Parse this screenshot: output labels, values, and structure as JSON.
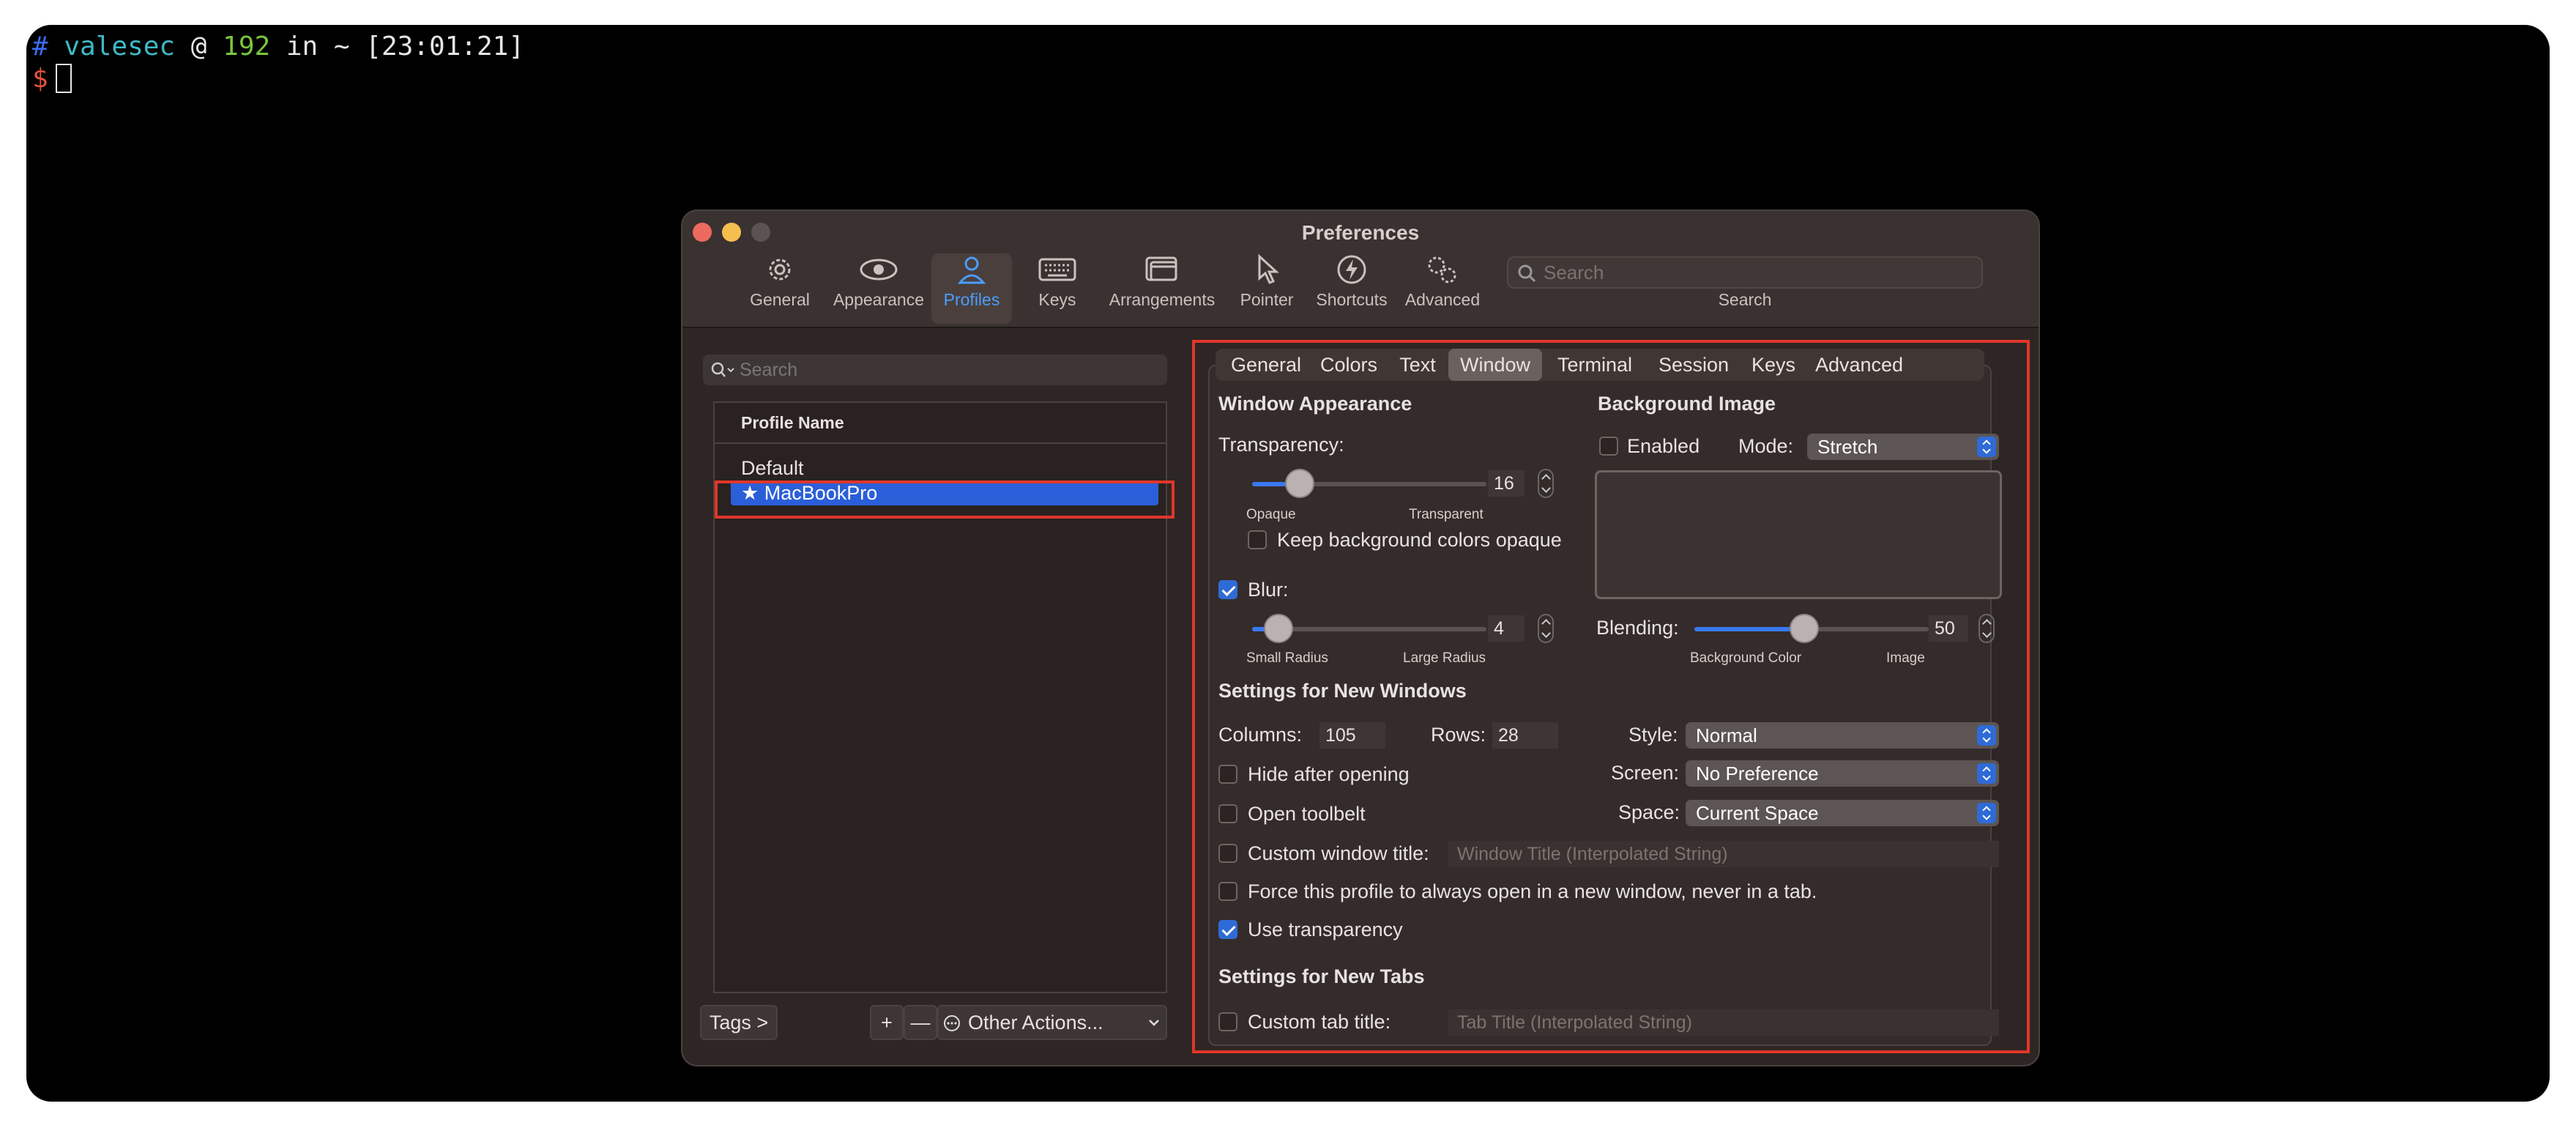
{
  "terminal": {
    "prompt_hash": "#",
    "user": "valesec",
    "at": "@",
    "host": "192",
    "in_text": "in ~",
    "time": "[23:01:21]",
    "dollar": "$"
  },
  "window": {
    "title": "Preferences"
  },
  "toolbar": {
    "items": [
      {
        "label": "General",
        "icon": "gear-icon"
      },
      {
        "label": "Appearance",
        "icon": "eye-icon"
      },
      {
        "label": "Profiles",
        "icon": "person-icon",
        "active": true
      },
      {
        "label": "Keys",
        "icon": "keyboard-icon"
      },
      {
        "label": "Arrangements",
        "icon": "windows-icon"
      },
      {
        "label": "Pointer",
        "icon": "pointer-icon"
      },
      {
        "label": "Shortcuts",
        "icon": "bolt-icon"
      },
      {
        "label": "Advanced",
        "icon": "gears-icon"
      }
    ],
    "search_placeholder": "Search",
    "search_label": "Search"
  },
  "profiles": {
    "search_placeholder": "Search",
    "header": "Profile Name",
    "items": [
      "Default",
      "★ MacBookPro"
    ],
    "selected": "MacBookPro",
    "tags_button": "Tags >",
    "add": "+",
    "remove": "—",
    "other_actions": "Other Actions..."
  },
  "tabs": [
    "General",
    "Colors",
    "Text",
    "Window",
    "Terminal",
    "Session",
    "Keys",
    "Advanced"
  ],
  "active_tab": "Window",
  "window_appearance": {
    "heading": "Window Appearance",
    "transparency_label": "Transparency:",
    "transparency_value": "16",
    "transparency_fraction": 0.16,
    "opaque": "Opaque",
    "transparent": "Transparent",
    "keep_bg_opaque": "Keep background colors opaque",
    "blur_label": "Blur:",
    "blur_checked": true,
    "blur_value": "4",
    "small_radius": "Small Radius",
    "large_radius": "Large Radius"
  },
  "background_image": {
    "heading": "Background Image",
    "enabled_label": "Enabled",
    "mode_label": "Mode:",
    "mode_value": "Stretch",
    "blending_label": "Blending:",
    "blending_value": "50",
    "background_color": "Background Color",
    "image": "Image"
  },
  "new_windows": {
    "heading": "Settings for New Windows",
    "columns_label": "Columns:",
    "columns_value": "105",
    "rows_label": "Rows:",
    "rows_value": "28",
    "style_label": "Style:",
    "style_value": "Normal",
    "screen_label": "Screen:",
    "screen_value": "No Preference",
    "space_label": "Space:",
    "space_value": "Current Space",
    "hide_after_opening": "Hide after opening",
    "open_toolbelt": "Open toolbelt",
    "custom_window_title": "Custom window title:",
    "window_title_placeholder": "Window Title (Interpolated String)",
    "force_new_window": "Force this profile to always open in a new window, never in a tab.",
    "use_transparency": "Use transparency",
    "use_transparency_checked": true
  },
  "new_tabs": {
    "heading": "Settings for New Tabs",
    "custom_tab_title": "Custom tab title:",
    "tab_title_placeholder": "Tab Title (Interpolated String)"
  },
  "colors": {
    "highlight": "#e0362a",
    "accent": "#2f6bd6"
  }
}
